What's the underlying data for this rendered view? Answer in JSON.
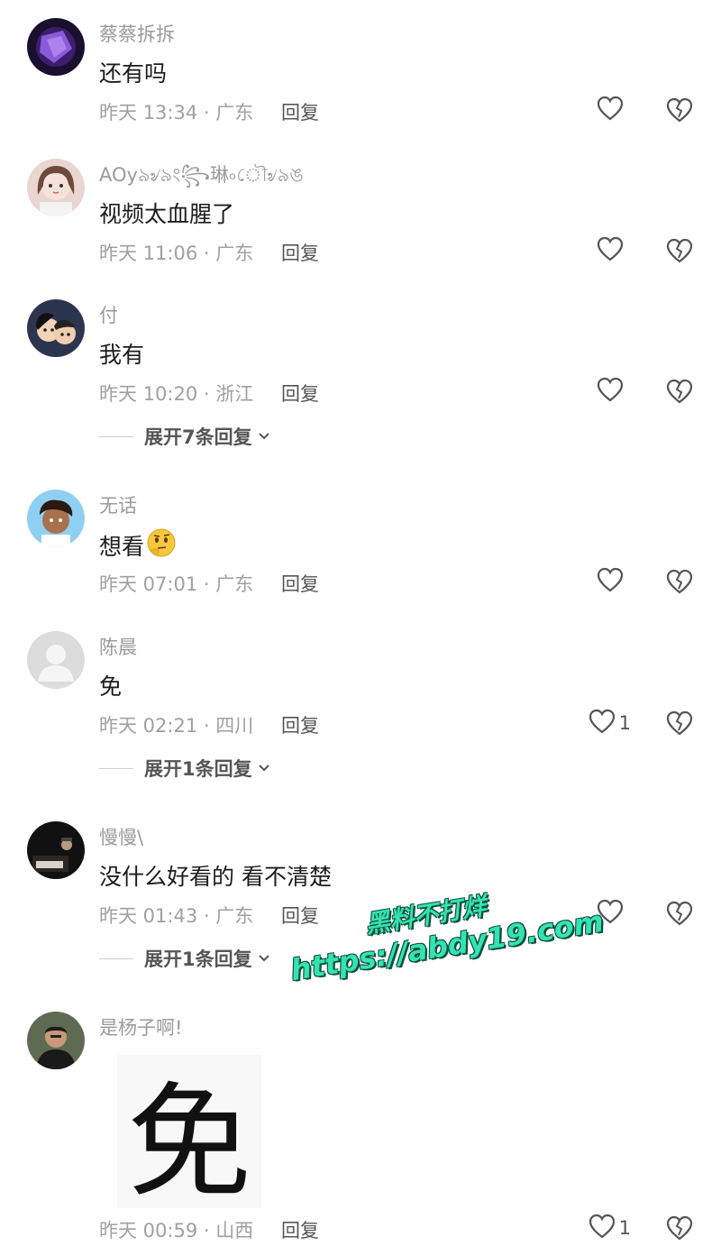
{
  "comments": [
    {
      "user": "蔡蔡拆拆",
      "text": "还有吗",
      "meta": "昨天 13:34 · 广东",
      "reply": "回复",
      "likes": "",
      "avatar": "dark-purple-avatar-icon"
    },
    {
      "user": "AOy৯৶৯ং꧂琳৹ৌ৶৯ঙ",
      "text": "视频太血腥了",
      "meta": "昨天 11:06 · 广东",
      "reply": "回复",
      "likes": "",
      "avatar": "girl-avatar-icon"
    },
    {
      "user": "付",
      "text": "我有",
      "meta": "昨天 10:20 · 浙江",
      "reply": "回复",
      "likes": "",
      "expand": "展开7条回复",
      "avatar": "anime-couple-avatar-icon"
    },
    {
      "user": "无话",
      "text": "想看",
      "meta": "昨天 07:01 · 广东",
      "reply": "回复",
      "likes": "",
      "avatar": "cartoon-kid-avatar-icon",
      "emoji": "thinking-emoji-icon"
    },
    {
      "user": "陈晨",
      "text": "免",
      "meta": "昨天 02:21 · 四川",
      "reply": "回复",
      "likes": "1",
      "expand": "展开1条回复",
      "avatar": "default-avatar-icon"
    },
    {
      "user": "慢慢\\",
      "text": "没什么好看的 看不清楚",
      "meta": "昨天 01:43 · 广东",
      "reply": "回复",
      "likes": "",
      "expand": "展开1条回复",
      "avatar": "dark-photo-avatar-icon"
    },
    {
      "user": "是杨子啊!",
      "text": "",
      "sticker": "免",
      "meta": "昨天 00:59 · 山西",
      "reply": "回复",
      "likes": "1",
      "avatar": "man-photo-avatar-icon"
    }
  ],
  "watermark": {
    "line1": "黑料不打烊",
    "line2": "https://abdy19.com",
    "color": "#34e3b3"
  },
  "colors": {
    "username": "#9b9b9b",
    "text": "#1c1c1c",
    "meta": "#a0a0a0",
    "action": "#555555"
  }
}
